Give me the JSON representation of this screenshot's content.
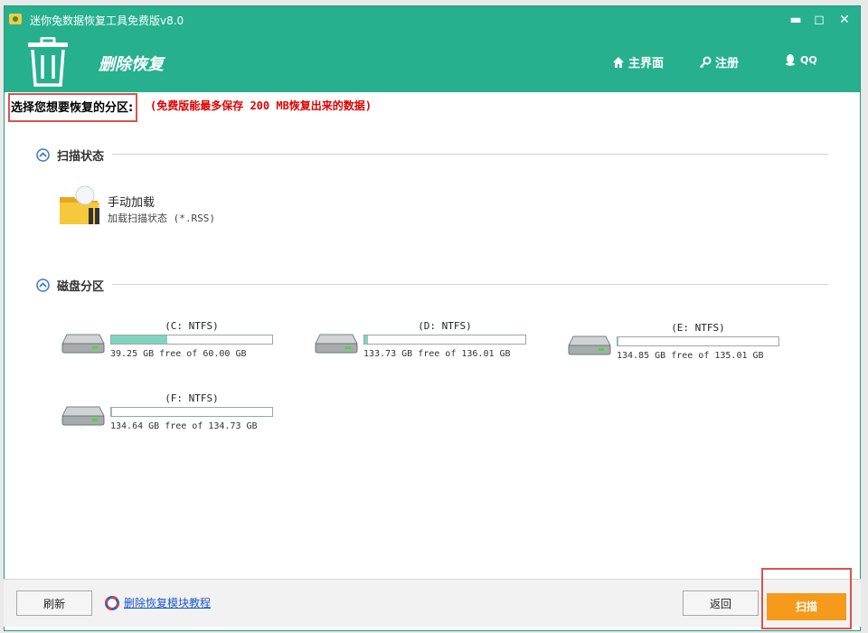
{
  "titlebar": {
    "title": "迷你兔数据恢复工具免费版v8.0",
    "minimize_icon": "minimize-icon",
    "maximize_icon": "maximize-icon",
    "close_icon": "close-icon"
  },
  "header": {
    "module_title": "删除恢复",
    "nav": [
      {
        "label": "主界面",
        "icon": "home-icon"
      },
      {
        "label": "注册",
        "icon": "key-icon"
      },
      {
        "label": "QQ",
        "icon": "qq-icon"
      }
    ],
    "color": "#26b08e"
  },
  "instruction": {
    "label": "选择您想要恢复的分区:",
    "note": "(免费版能最多保存 200 MB恢复出来的数据)"
  },
  "scan_status": {
    "heading": "扫描状态",
    "item_title": "手动加载",
    "item_sub": "加载扫描状态 (*.RSS)"
  },
  "partitions": {
    "heading": "磁盘分区",
    "drives": [
      {
        "name": "(C: NTFS)",
        "free": "39.25 GB free of 60.00 GB",
        "used_fraction": 0.35
      },
      {
        "name": "(D: NTFS)",
        "free": "133.73 GB free of 136.01 GB",
        "used_fraction": 0.02
      },
      {
        "name": "(E: NTFS)",
        "free": "134.85 GB free of 135.01 GB",
        "used_fraction": 0.0
      },
      {
        "name": "(F: NTFS)",
        "free": "134.64 GB free of 134.73 GB",
        "used_fraction": 0.0
      }
    ]
  },
  "footer": {
    "refresh": "刷新",
    "tutorial": "删除恢复模块教程",
    "back": "返回",
    "scan": "扫描"
  }
}
